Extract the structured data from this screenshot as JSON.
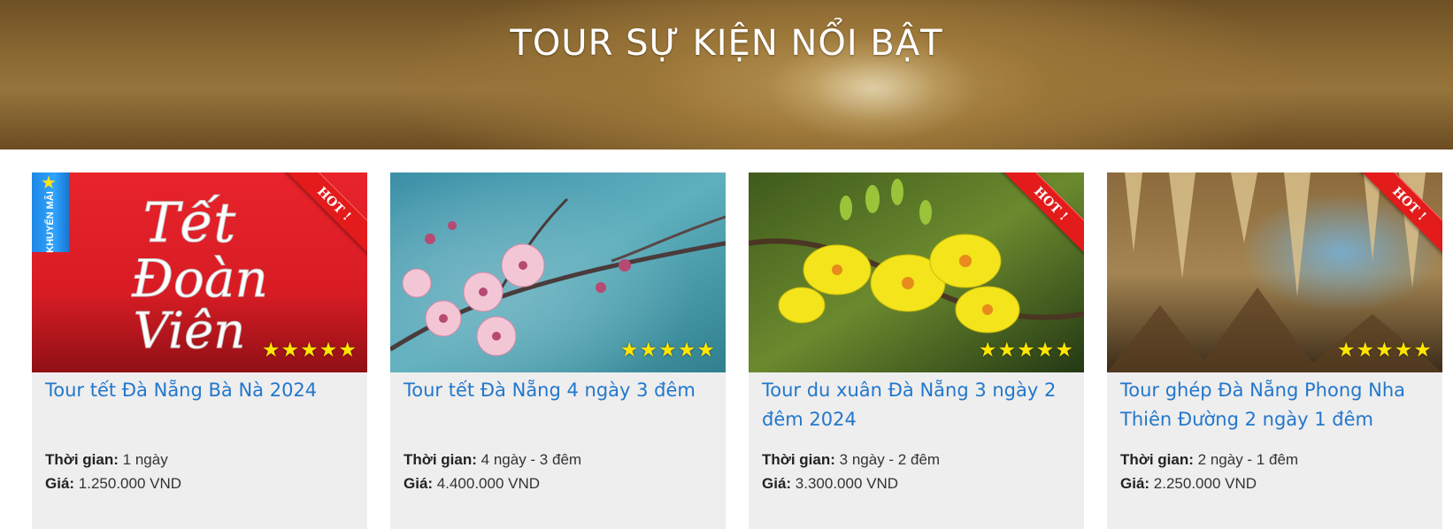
{
  "section": {
    "title": "TOUR SỰ KIỆN NỔI BẬT"
  },
  "labels": {
    "time": "Thời gian:",
    "price": "Giá:"
  },
  "colors": {
    "title_link": "#2277cc",
    "hot_ribbon": "#e31b1b",
    "star": "#ffe600",
    "card_bg": "#eeeeee"
  },
  "tours": [
    {
      "title": "Tour tết Đà Nẵng Bà Nà 2024",
      "duration": "1 ngày",
      "price": "1.250.000 VND",
      "hot_label": "HOT !",
      "rating": 5,
      "promo_label": "KHUYẾN MÃI",
      "image_text": [
        "Tết",
        "Đoàn",
        "Viên"
      ],
      "image": "tet-doan-vien-red-banner"
    },
    {
      "title": "Tour tết Đà Nẵng 4 ngày 3 đêm",
      "duration": "4 ngày - 3 đêm",
      "price": "4.400.000 VND",
      "rating": 5,
      "image": "pink-peach-blossom"
    },
    {
      "title": "Tour du xuân Đà Nẵng 3 ngày 2 đêm 2024",
      "duration": "3 ngày - 2 đêm",
      "price": "3.300.000 VND",
      "hot_label": "HOT !",
      "rating": 5,
      "image": "yellow-apricot-blossom"
    },
    {
      "title": "Tour ghép Đà Nẵng Phong Nha Thiên Đường 2 ngày 1 đêm",
      "duration": "2 ngày - 1 đêm",
      "price": "2.250.000 VND",
      "hot_label": "HOT !",
      "rating": 5,
      "image": "cave-stalactites"
    }
  ]
}
